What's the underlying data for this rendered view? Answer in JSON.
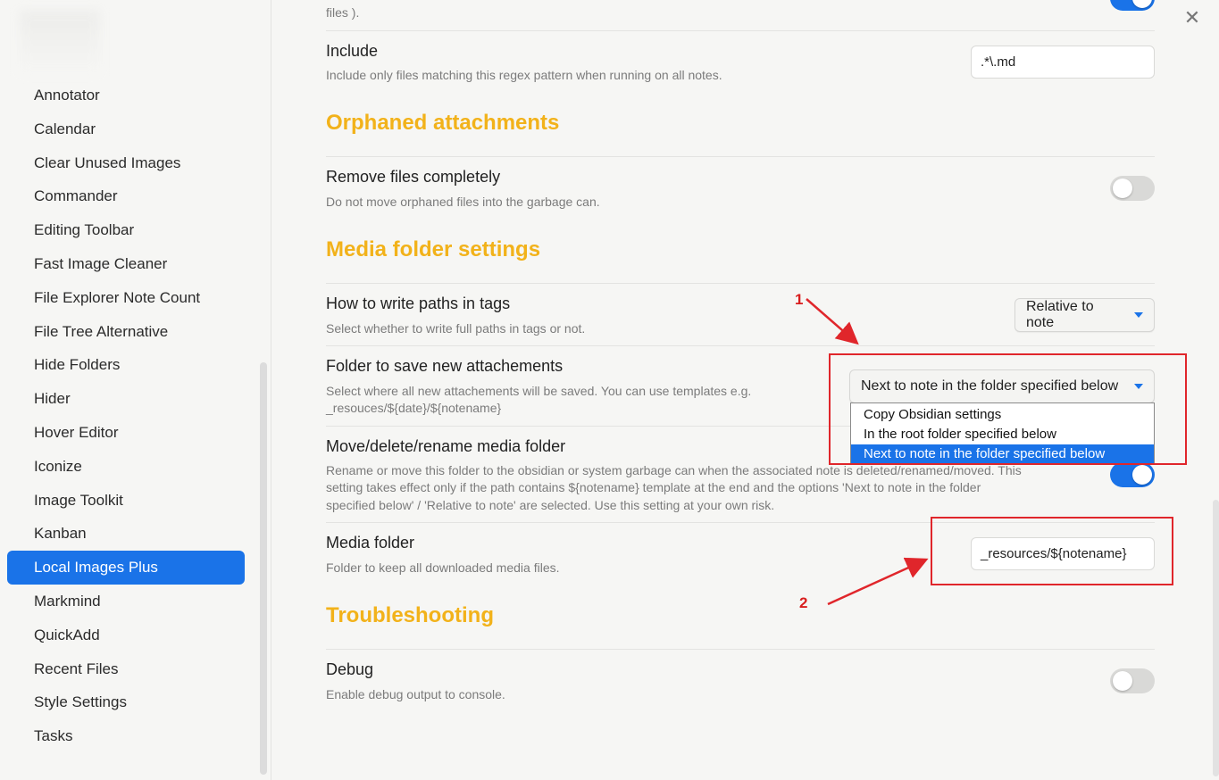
{
  "sidebar": {
    "items": [
      {
        "label": "Annotator"
      },
      {
        "label": "Calendar"
      },
      {
        "label": "Clear Unused Images"
      },
      {
        "label": "Commander"
      },
      {
        "label": "Editing Toolbar"
      },
      {
        "label": "Fast Image Cleaner"
      },
      {
        "label": "File Explorer Note Count"
      },
      {
        "label": "File Tree Alternative"
      },
      {
        "label": "Hide Folders"
      },
      {
        "label": "Hider"
      },
      {
        "label": "Hover Editor"
      },
      {
        "label": "Iconize"
      },
      {
        "label": "Image Toolkit"
      },
      {
        "label": "Kanban"
      },
      {
        "label": "Local Images Plus"
      },
      {
        "label": "Markmind"
      },
      {
        "label": "QuickAdd"
      },
      {
        "label": "Recent Files"
      },
      {
        "label": "Style Settings"
      },
      {
        "label": "Tasks"
      }
    ],
    "active_label": "Local Images Plus"
  },
  "top_fragment": "files ).",
  "close_icon": "close-icon",
  "settings": {
    "include": {
      "title": "Include",
      "desc": "Include only files matching this regex pattern when running on all notes.",
      "value": ".*\\.md"
    },
    "orphaned_heading": "Orphaned attachments",
    "remove_files": {
      "title": "Remove files completely",
      "desc": "Do not move orphaned files into the garbage can.",
      "enabled": false
    },
    "media_heading": "Media folder settings",
    "write_paths": {
      "title": "How to write paths in tags",
      "desc": "Select whether to write full paths in tags or not.",
      "value": "Relative to note"
    },
    "save_folder": {
      "title": "Folder to save new attachements",
      "desc_line1": "Select where all new attachements will be saved. You can use templates e.g.",
      "desc_line2": "_resouces/${date}/${notename}",
      "value": "Next to note in the folder specified below",
      "options": [
        "Copy Obsidian settings",
        "In the root folder specified below",
        "Next to note in the folder specified below"
      ]
    },
    "move_media": {
      "title": "Move/delete/rename media folder",
      "desc_line1": "Rename or move this folder to the obsidian or system garbage can when the associated note is deleted/renamed/moved. This",
      "desc_line2": "setting takes effect only if the path contains ${notename} template at the end and the options 'Next to note in the folder",
      "desc_line3": "specified below' / 'Relative to note' are selected. Use this setting at your own risk.",
      "enabled": true
    },
    "media_folder": {
      "title": "Media folder",
      "desc": "Folder to keep all downloaded media files.",
      "value": "_resources/${notename}"
    },
    "troubleshooting_heading": "Troubleshooting",
    "debug": {
      "title": "Debug",
      "desc": "Enable debug output to console.",
      "enabled": false
    }
  },
  "annotations": {
    "label_1": "1",
    "label_2": "2",
    "color": "#e0262b"
  },
  "colors": {
    "accent": "#1a73e8",
    "heading": "#f2b21a"
  }
}
